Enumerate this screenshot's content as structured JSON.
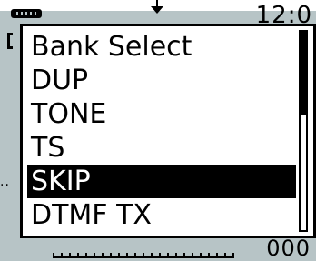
{
  "status": {
    "clock": "12:0",
    "battery_icon": "battery-icon",
    "bottom_value": "000"
  },
  "menu": {
    "items": [
      {
        "label": "Bank Select",
        "selected": false
      },
      {
        "label": "DUP",
        "selected": false
      },
      {
        "label": "TONE",
        "selected": false
      },
      {
        "label": "TS",
        "selected": false
      },
      {
        "label": "SKIP",
        "selected": true
      },
      {
        "label": "DTMF TX",
        "selected": false
      }
    ]
  },
  "colors": {
    "lcd_background": "#b7c4c6",
    "menu_background": "#ffffff",
    "selection": "#000000"
  }
}
